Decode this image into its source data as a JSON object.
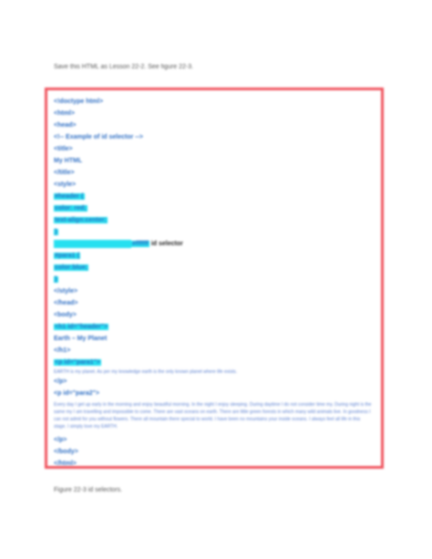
{
  "intro_text": "Save this HTML as Lesson 22-2. See figure 22-3.",
  "code_lines": {
    "l01": "<!doctype html>",
    "l02": "<html>",
    "l03": "<head>",
    "l04": "<!-- Example of id selector -->",
    "l05": "<title>",
    "l06": "My HTML",
    "l07": "</title>",
    "l08": "<style>",
    "l09": "#header {",
    "l10": "color: red;",
    "l11": "text-align:center;",
    "l12": "}",
    "l13": "#ffffff",
    "l13_note": "id selector",
    "l14": "#para1 {",
    "l15": "color:blue;",
    "l16": "}",
    "l17": "</style>",
    "l18": "</head>",
    "l19": "<body>",
    "l20": "<h1 id=\"header\">",
    "l21": "Earth – My Planet",
    "l22": "</h1>",
    "l23": "<p id=\"para1\">",
    "l24": "EARTH is my planet. As per my knowledge earth is the only known planet where life exists.",
    "l25": "</p>",
    "l26": "<p id=\"para2\">",
    "l27": "Every day I get up early in the morning and enjoy beautiful morning. In the night I enjoy sleeping. During daytime I do not consider time my. During night is the same my I am travelling and impossible to come. There are vast oceans on earth. There are little green forests in which many wild animals live. In goodness I can not admit for you without flowers. There all mountain there special to world. I have been no mountains your inside oceans. I always feel all life in this stage. I simply love my EARTH.",
    "l28": "</p>",
    "l29": "</body>",
    "l30": "</html>"
  },
  "caption_text": "Figure 22-3 id selectors.",
  "colors": {
    "border": "#f0555f",
    "code_text": "#2f6fc4",
    "highlight": "#26e0f0"
  }
}
